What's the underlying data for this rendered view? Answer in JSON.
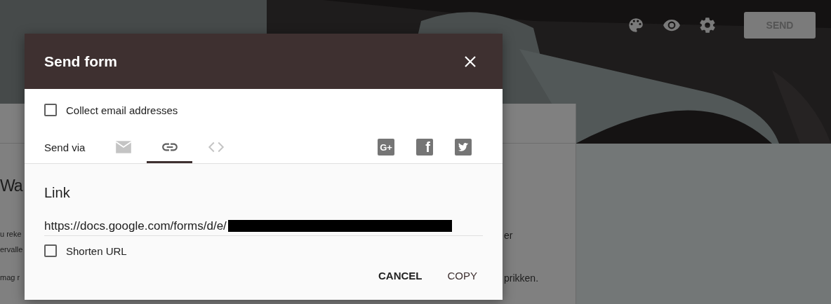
{
  "toolbar": {
    "send_button": {
      "label": "SEND",
      "disabled": true
    }
  },
  "form_behind": {
    "title_fragment": "Wa",
    "left_fragments": [
      "u reke",
      "ervalle",
      "mag r"
    ],
    "right_fragments": [
      "er",
      "prikken."
    ]
  },
  "dialog": {
    "title": "Send form",
    "collect_email": {
      "label": "Collect email addresses",
      "checked": false
    },
    "send_via_label": "Send via",
    "tabs": [
      {
        "kind": "email",
        "selected": false
      },
      {
        "kind": "link",
        "selected": true
      },
      {
        "kind": "embed",
        "selected": false
      }
    ],
    "share": [
      {
        "kind": "gplus",
        "label": "G+"
      },
      {
        "kind": "facebook",
        "label": "f"
      },
      {
        "kind": "twitter"
      }
    ],
    "link_heading": "Link",
    "url": "https://docs.google.com/forms/d/e/",
    "shorten_url": {
      "label": "Shorten URL",
      "checked": false
    },
    "buttons": [
      "CANCEL",
      "COPY"
    ]
  }
}
